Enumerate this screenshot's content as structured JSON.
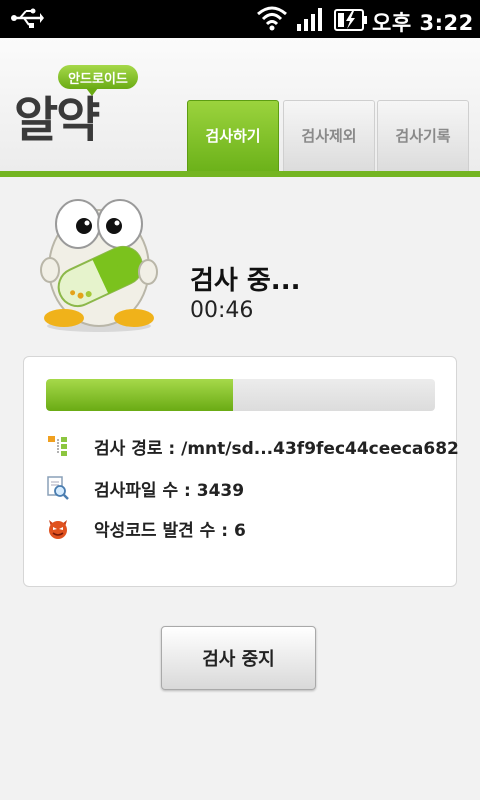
{
  "status_bar": {
    "time": "오후 3:22"
  },
  "header": {
    "logo_sub": "안드로이드",
    "logo_main": "알약",
    "tabs": [
      {
        "label": "검사하기",
        "active": true
      },
      {
        "label": "검사제외",
        "active": false
      },
      {
        "label": "검사기록",
        "active": false
      }
    ]
  },
  "scan": {
    "title": "검사 중...",
    "elapsed": "00:46",
    "progress_fraction": 0.48,
    "path_text": "검사 경로 : /mnt/sd...43f9fec44ceeca682",
    "file_count_text": "검사파일 수 : 3439",
    "malware_text": "악성코드 발견 수 : 6"
  },
  "actions": {
    "stop_label": "검사 중지"
  },
  "colors": {
    "accent": "#74b521",
    "status_bar": "#000000"
  }
}
